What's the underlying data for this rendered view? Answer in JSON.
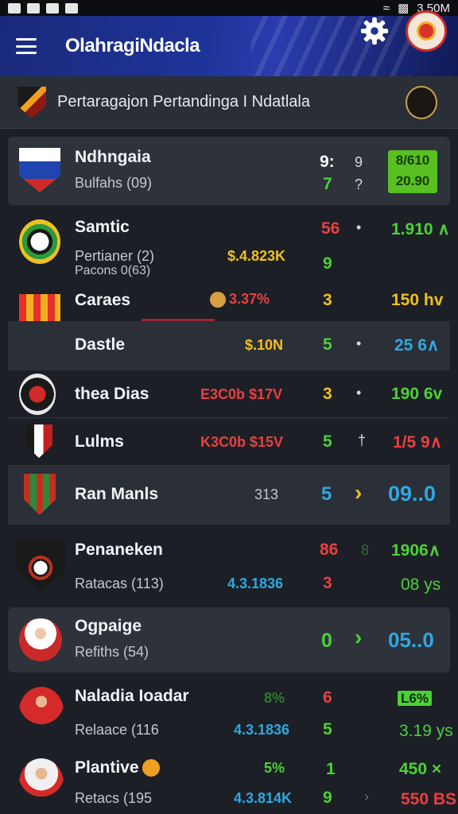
{
  "status_bar": {
    "right_text": "3.50M"
  },
  "header": {
    "title": "OlahragiNdacla"
  },
  "subheader": {
    "title": "Pertaragajon Pertandinga I Ndatlala"
  },
  "colors": {
    "appbar": "#1e3399",
    "green": "#4cd137",
    "red": "#e84040",
    "yellow": "#f0c020",
    "blue": "#2fa8e0",
    "box_green": "#58c020"
  },
  "matches": [
    {
      "name": "Ndhngaia",
      "sub": "Bulfahs (09)",
      "odds": "",
      "n1": "9:",
      "n2": "7",
      "a1": "9",
      "a2": "?",
      "box1": "8/610",
      "box2": "20.90"
    },
    {
      "name": "Samtic",
      "sub": "Pertianer (2)",
      "sub2": "Pacons 0(63)",
      "odds": "$.4.823K",
      "n1": "56",
      "n2": "9",
      "a1": "•",
      "price": "1.910 ∧"
    },
    {
      "name": "Caraes",
      "odds": "3.37%",
      "n1": "3",
      "price": "150 hv"
    },
    {
      "name": "Dastle",
      "odds": "$.10N",
      "n1": "5",
      "a1": "•",
      "price": "25 6∧"
    },
    {
      "name": "thea Dias",
      "odds": "E3C0b $17V",
      "n1": "3",
      "a1": "•",
      "price": "190 6v"
    },
    {
      "name": "Lulms",
      "odds": "K3C0b $15V",
      "n1": "5",
      "a1": "†",
      "price": "1/5 9∧"
    },
    {
      "name": "Ran Manls",
      "odds": "313",
      "n1": "5",
      "a1": "›",
      "price": "09..0"
    },
    {
      "name": "Penaneken",
      "sub": "Ratacas (113)",
      "odds": "4.3.1836",
      "n1": "86",
      "n2": "3",
      "a1": "8",
      "price": "1906∧",
      "price2": "08 ys"
    },
    {
      "name": "Ogpaige",
      "sub": "Refiths (54)",
      "n1": "0",
      "a1": "›",
      "price": "05..0"
    },
    {
      "name": "Naladia Ioadar",
      "sub": "Relaace (116",
      "odds": "8%",
      "odds2": "4.3.1836",
      "n1": "6",
      "n2": "5",
      "price": "L6%",
      "price2": "3.19 ys"
    },
    {
      "name": "Plantive",
      "sub": "Retacs (195",
      "odds": "5%",
      "odds2": "4.3.814K",
      "n1": "1",
      "n2": "9",
      "a1": "›",
      "price": "450 ×",
      "price2": "550 BS"
    }
  ]
}
